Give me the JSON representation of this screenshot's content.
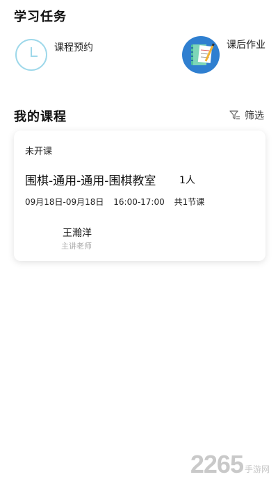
{
  "learning_tasks": {
    "title": "学习任务",
    "items": [
      {
        "label": "课程预约",
        "icon": "clock-icon"
      },
      {
        "label": "课后作业",
        "icon": "homework-notebook-icon"
      }
    ]
  },
  "my_courses": {
    "title": "我的课程",
    "filter_label": "筛选",
    "cards": [
      {
        "status": "未开课",
        "name": "围棋-通用-通用-围棋教室",
        "people": "1人",
        "dates": "09月18日-09月18日",
        "time": "16:00-17:00",
        "sessions": "共1节课",
        "teacher_name": "王瀚洋",
        "teacher_role": "主讲老师"
      }
    ]
  },
  "watermark": {
    "number": "2265",
    "text": "手游网"
  },
  "colors": {
    "clock_accent": "#9ed8ea",
    "homework_bg": "#2f7fd0"
  }
}
